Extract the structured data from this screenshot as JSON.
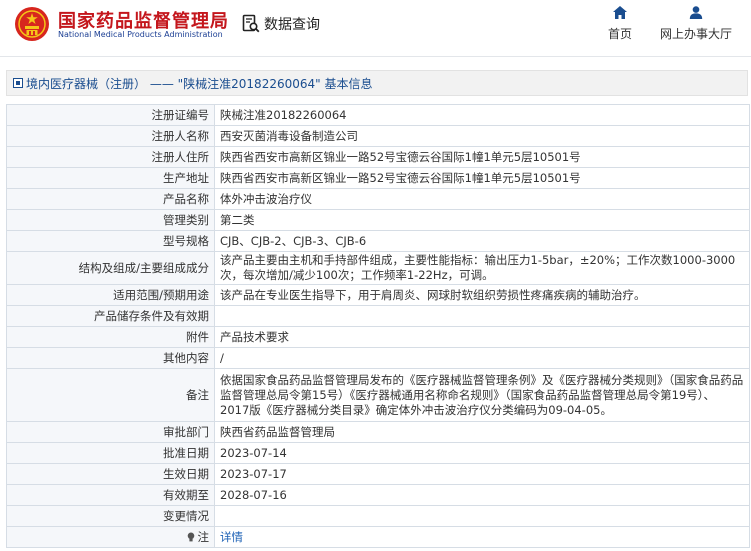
{
  "header": {
    "site_name_cn": "国家药品监督管理局",
    "site_name_en": "National Medical Products Administration",
    "data_query": "数据查询",
    "nav": {
      "home": "首页",
      "online": "网上办事大厅"
    },
    "brand_red": "#c4161c",
    "brand_blue": "#1c3f94"
  },
  "breadcrumb": {
    "text": "境内医疗器械（注册） —— \"陕械注准20182260064\" 基本信息"
  },
  "details": [
    {
      "label": "注册证编号",
      "value": "陕械注准20182260064"
    },
    {
      "label": "注册人名称",
      "value": "西安灭菌消毒设备制造公司"
    },
    {
      "label": "注册人住所",
      "value": "陕西省西安市高新区锦业一路52号宝德云谷国际1幢1单元5层10501号"
    },
    {
      "label": "生产地址",
      "value": "陕西省西安市高新区锦业一路52号宝德云谷国际1幢1单元5层10501号"
    },
    {
      "label": "产品名称",
      "value": "体外冲击波治疗仪"
    },
    {
      "label": "管理类别",
      "value": "第二类"
    },
    {
      "label": "型号规格",
      "value": "CJB、CJB-2、CJB-3、CJB-6"
    },
    {
      "label": "结构及组成/主要组成成分",
      "value": "该产品主要由主机和手持部件组成，主要性能指标：输出压力1-5bar，±20%；工作次数1000-3000次，每次增加/减少100次；工作频率1-22Hz，可调。"
    },
    {
      "label": "适用范围/预期用途",
      "value": "该产品在专业医生指导下，用于肩周炎、网球肘软组织劳损性疼痛疾病的辅助治疗。"
    },
    {
      "label": "产品储存条件及有效期",
      "value": ""
    },
    {
      "label": "附件",
      "value": "产品技术要求"
    },
    {
      "label": "其他内容",
      "value": "/"
    },
    {
      "label": "备注",
      "value": "依据国家食品药品监督管理局发布的《医疗器械监督管理条例》及《医疗器械分类规则》（国家食品药品监督管理总局令第15号）《医疗器械通用名称命名规则》（国家食品药品监督管理总局令第19号）、2017版《医疗器械分类目录》确定体外冲击波治疗仪分类编码为09-04-05。"
    },
    {
      "label": "审批部门",
      "value": "陕西省药品监督管理局"
    },
    {
      "label": "批准日期",
      "value": "2023-07-14"
    },
    {
      "label": "生效日期",
      "value": "2023-07-17"
    },
    {
      "label": "有效期至",
      "value": "2028-07-16"
    },
    {
      "label": "变更情况",
      "value": ""
    }
  ],
  "note": {
    "label": "注",
    "link": "详情",
    "icon": "lightbulb-icon"
  }
}
